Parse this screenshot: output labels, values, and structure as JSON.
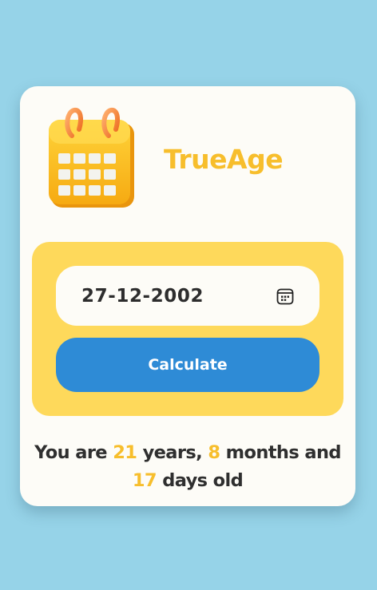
{
  "app": {
    "title": "TrueAge",
    "logo_icon": "calendar-icon"
  },
  "form": {
    "date_value": "27-12-2002",
    "date_icon": "calendar-picker-icon",
    "calculate_label": "Calculate"
  },
  "result": {
    "prefix": "You are",
    "years": "21",
    "years_label": "years,",
    "months": "8",
    "months_label": "months and",
    "days": "17",
    "days_label": "days old"
  },
  "colors": {
    "background": "#96d3e8",
    "card": "#fdfcf7",
    "panel": "#fed95b",
    "accent_yellow": "#f7be2c",
    "button_blue": "#2e8bd6",
    "text_dark": "#2f2f2f"
  }
}
